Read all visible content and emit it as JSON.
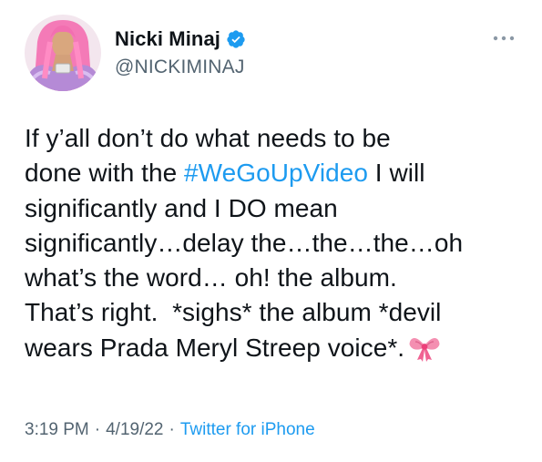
{
  "author": {
    "display_name": "Nicki Minaj",
    "handle": "@NICKIMINAJ",
    "verified_icon": "verified-badge-icon",
    "avatar_icon": "avatar-photo"
  },
  "more_icon": "more-options-icon",
  "tweet": {
    "line1": "If y’all don’t do what needs to be",
    "line2_pre": "done with the ",
    "hashtag": "#WeGoUpVideo",
    "line2_post": " I will",
    "line3": "significantly and I DO mean",
    "line4": "significantly…delay the…the…the…oh",
    "line5": "what’s the word… oh! the album.",
    "line6": "That’s right.  *sighs* the album *devil",
    "line7": "wears Prada Meryl Streep voice*.",
    "emoji_icon": "ribbon-bow-emoji"
  },
  "meta": {
    "time": "3:19 PM",
    "separator": "·",
    "date": "4/19/22",
    "source": "Twitter for iPhone"
  },
  "colors": {
    "link": "#1d9bf0",
    "secondary_text": "#536471",
    "primary_text": "#0f1419",
    "avatar_hair": "#f26fb0"
  }
}
